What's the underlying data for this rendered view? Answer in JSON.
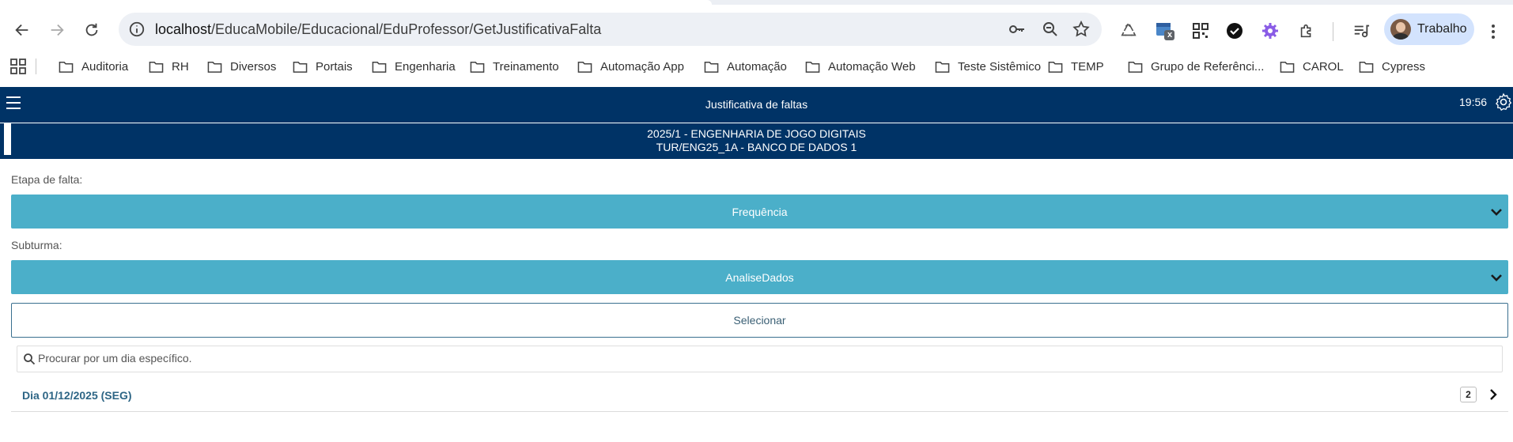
{
  "browser": {
    "url_host": "localhost",
    "url_path": "/EducaMobile/Educacional/EduProfessor/GetJustificativaFalta",
    "profile_name": "Trabalho",
    "bookmarks": [
      {
        "label": "Auditoria"
      },
      {
        "label": "RH"
      },
      {
        "label": "Diversos"
      },
      {
        "label": "Portais"
      },
      {
        "label": "Engenharia"
      },
      {
        "label": "Treinamento"
      },
      {
        "label": "Automação App"
      },
      {
        "label": "Automação"
      },
      {
        "label": "Automação Web"
      },
      {
        "label": "Teste Sistêmico"
      },
      {
        "label": "TEMP"
      },
      {
        "label": "Grupo de Referênci..."
      },
      {
        "label": "CAROL"
      },
      {
        "label": "Cypress"
      }
    ],
    "extension_badge": "x"
  },
  "app": {
    "title": "Justificativa de faltas",
    "time": "19:56",
    "course_line1": "2025/1 - ENGENHARIA DE JOGO DIGITAIS",
    "course_line2": "TUR/ENG25_1A - BANCO DE DADOS 1",
    "etapa_label": "Etapa de falta:",
    "etapa_value": "Frequência",
    "subturma_label": "Subturma:",
    "subturma_value": "AnaliseDados",
    "select_button": "Selecionar",
    "search_placeholder": "Procurar por um dia específico.",
    "days": [
      {
        "label": "Dia 01/12/2025 (SEG)",
        "count": "2"
      }
    ]
  },
  "colors": {
    "header_bg": "#003366",
    "select_bg": "#4bafc9",
    "day_text": "#2d6585"
  }
}
